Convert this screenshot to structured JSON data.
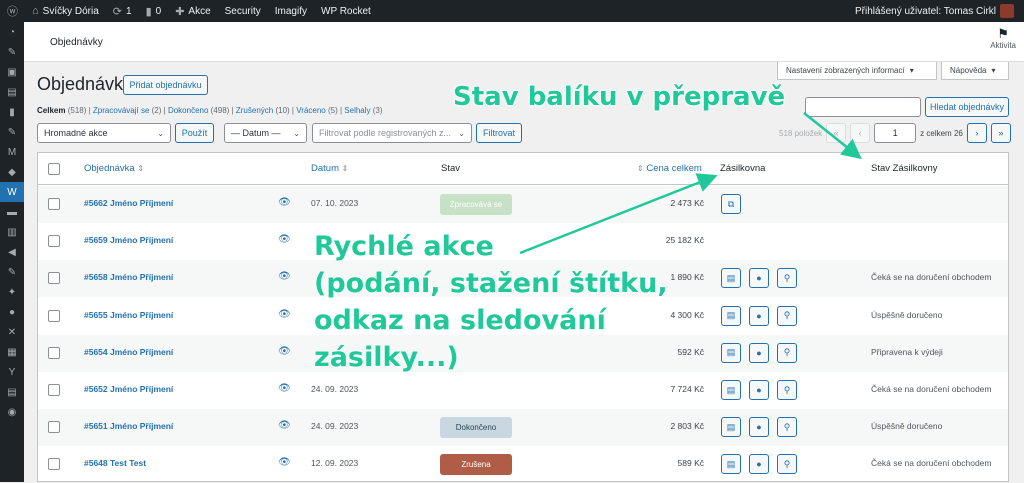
{
  "adminbar": {
    "wp_logo_icon": "wordpress-icon",
    "site_name": "Svíčky Dória",
    "updates_count": "1",
    "comments_count": "0",
    "new_label": "Akce",
    "security": "Security",
    "imagify": "Imagify",
    "wprocket": "WP Rocket",
    "user_greeting": "Přihlášený uživatel: Tomas Cirkl"
  },
  "topbar": {
    "page_title": "Objednávky",
    "activity_label": "Aktivita"
  },
  "screen_options": "Nastavení zobrazených informací",
  "help": "Nápověda",
  "heading": "Objednávky",
  "add_order": "Přidat objednávku",
  "subsub": {
    "all": "Celkem",
    "all_count": "(518)",
    "processing": "Zpracovávají se",
    "processing_count": "(2)",
    "completed": "Dokončeno",
    "completed_count": "(498)",
    "cancelled": "Zrušených",
    "cancelled_count": "(10)",
    "refunded": "Vráceno",
    "refunded_count": "(5)",
    "failed": "Selhaly",
    "failed_count": "(3)"
  },
  "search_button": "Hledat objednávky",
  "bulk_actions": "Hromadné akce",
  "apply": "Použít",
  "date_filter": "— Datum —",
  "customer_filter": "Filtrovat podle registrovaných z...",
  "filter_button": "Filtrovat",
  "pagination": {
    "items": "518 položek",
    "current_page": "1",
    "of_total": "z celkem 26"
  },
  "columns": {
    "order": "Objednávka",
    "date": "Datum",
    "status": "Stav",
    "total": "Cena celkem",
    "zasilkovna": "Zásilkovna",
    "zasilkovna_status": "Stav Zásilkovny"
  },
  "colors": {
    "processing": "#c6e1c6",
    "completed": "#c8d7e1",
    "cancelled": "#e5e5e5",
    "failed": "#eba3a3",
    "zrusena": "#b05d48",
    "annotation": "#20c89a"
  },
  "orders": [
    {
      "number": "#5662 Jméno Příjmení",
      "date": "07. 10. 2023",
      "status": "Zpracovává se",
      "total": "2 473 Kč",
      "zasilkovna_status": ""
    },
    {
      "number": "#5659 Jméno Příjmení",
      "date": "",
      "status": "",
      "total": "25 182 Kč",
      "zasilkovna_status": ""
    },
    {
      "number": "#5658 Jméno Příjmení",
      "date": "",
      "status": "",
      "total": "1 890 Kč",
      "zasilkovna_status": "Čeká se na doručení obchodem"
    },
    {
      "number": "#5655 Jméno Příjmení",
      "date": "",
      "status": "",
      "total": "4 300 Kč",
      "zasilkovna_status": "Úspěšně doručeno"
    },
    {
      "number": "#5654 Jméno Příjmení",
      "date": "",
      "status": "",
      "total": "592 Kč",
      "zasilkovna_status": "Připravena k výdeji"
    },
    {
      "number": "#5652 Jméno Příjmení",
      "date": "24. 09. 2023",
      "status": "",
      "total": "7 724 Kč",
      "zasilkovna_status": "Čeká se na doručení obchodem"
    },
    {
      "number": "#5651 Jméno Příjmení",
      "date": "24. 09. 2023",
      "status": "Dokončeno",
      "total": "2 803 Kč",
      "zasilkovna_status": "Úspěšně doručeno"
    },
    {
      "number": "#5648 Test Test",
      "date": "12. 09. 2023",
      "status": "Zrušena",
      "total": "589 Kč",
      "zasilkovna_status": "Čeká se na doručení obchodem"
    }
  ],
  "annotations": {
    "top": "Stav balíku v přepravě",
    "line1": "Rychlé akce",
    "line2": "(podání, stažení štítku,",
    "line3": "odkaz na sledování",
    "line4": "zásilky...)"
  }
}
